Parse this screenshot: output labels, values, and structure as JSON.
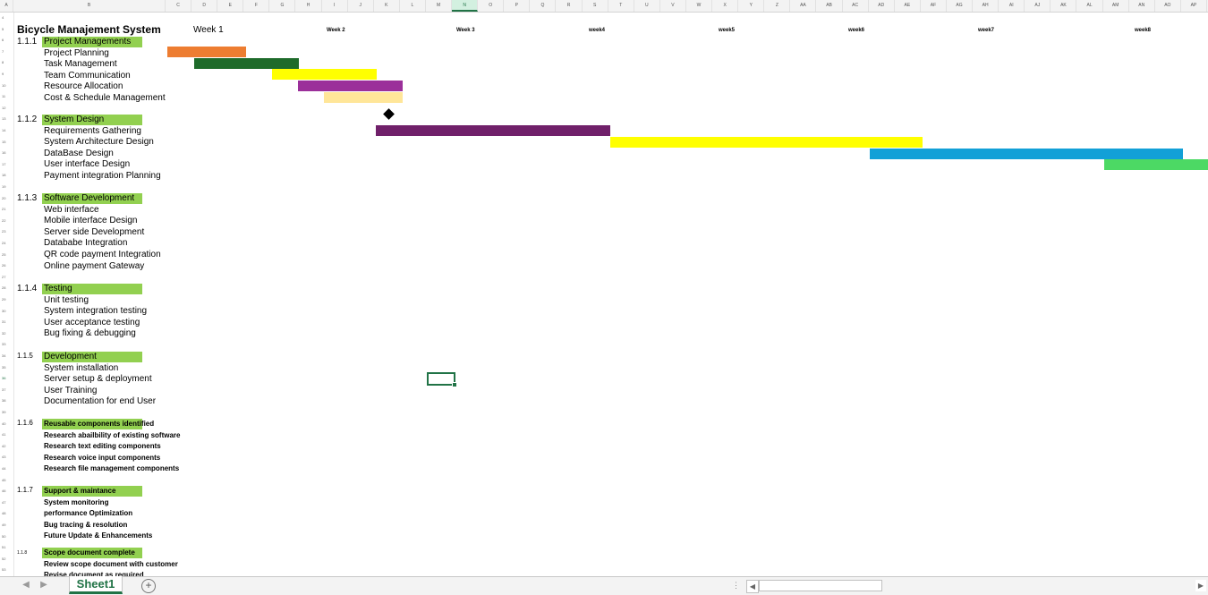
{
  "sheet": {
    "title": "Bicycle Manajement System",
    "week_labels": [
      "Week 1",
      "Week 2",
      "Week 3",
      "week4",
      "week5",
      "week6",
      "week7",
      "week8"
    ],
    "columns": [
      "A",
      "B",
      "C",
      "D",
      "E",
      "F",
      "G",
      "H",
      "I",
      "J",
      "K",
      "L",
      "M",
      "N",
      "O",
      "P",
      "Q",
      "R",
      "S",
      "T",
      "U",
      "V",
      "W",
      "X",
      "Y",
      "Z",
      "AA",
      "AB",
      "AC",
      "AD",
      "AE",
      "AF",
      "AG",
      "AH",
      "AI",
      "AJ",
      "AK",
      "AL",
      "AM",
      "AN",
      "AO",
      "AP",
      "AQ"
    ],
    "selected_column": "N",
    "row_numbers": [
      "4",
      "5",
      "6",
      "7",
      "8",
      "9",
      "10",
      "11",
      "12",
      "13",
      "14",
      "15",
      "16",
      "17",
      "18",
      "19",
      "20",
      "21",
      "22",
      "23",
      "24",
      "25",
      "26",
      "27",
      "28",
      "29",
      "30",
      "31",
      "32",
      "33",
      "34",
      "35",
      "36",
      "37",
      "38",
      "39",
      "40",
      "41",
      "42",
      "43",
      "44",
      "45",
      "46",
      "47",
      "48",
      "49",
      "50",
      "51",
      "52",
      "53",
      "54",
      "55"
    ],
    "selected_row": "36",
    "sections": [
      {
        "code": "1.1.1",
        "name": "Project Managements",
        "tasks": [
          "Project Planning",
          "Task Management",
          "Team Communication",
          "Resource Allocation",
          "Cost & Schedule Management"
        ]
      },
      {
        "code": "1.1.2",
        "name": "System Design",
        "tasks": [
          "Requirements Gathering",
          "System Architecture  Design",
          "DataBase Design",
          "User interface Design",
          "Payment integration Planning"
        ]
      },
      {
        "code": "1.1.3",
        "name": "Software Development",
        "tasks": [
          "Web interface",
          "Mobile interface Design",
          "Server side Development",
          "Datababe Integration",
          "QR code payment Integration",
          "Online payment Gateway"
        ]
      },
      {
        "code": "1.1.4",
        "name": "Testing",
        "tasks": [
          "Unit  testing",
          "System integration testing",
          "User  acceptance  testing",
          "Bug fixing &  debugging"
        ]
      },
      {
        "code": "1.1.5",
        "name": "Development",
        "tasks": [
          "System installation",
          "Server setup  & deployment",
          "User Training",
          "Documentation for end User"
        ]
      },
      {
        "code": "1.1.6",
        "name": "Reusable components identified",
        "tasks": [
          "Research abailbility of existing software",
          "Research text editing components",
          "Research voice input components",
          "Research file management components"
        ]
      },
      {
        "code": "1.1.7",
        "name": "Support & maintance",
        "tasks": [
          "System monitoring",
          "performance Optimization",
          "Bug tracing & resolution",
          "Future Update & Enhancements"
        ]
      },
      {
        "code": "1.1.8",
        "name": "Scope document complete",
        "tasks": [
          "Review scope document with customer",
          "Revise document as required"
        ]
      }
    ],
    "gantt_bars": [
      {
        "task": "Project Planning",
        "color": "#ed7d31"
      },
      {
        "task": "Task Management",
        "color": "#1e6b2a"
      },
      {
        "task": "Team Communication",
        "color": "#ffff00"
      },
      {
        "task": "Resource Allocation",
        "color": "#9b2f9a"
      },
      {
        "task": "Cost & Schedule Management",
        "color": "#ffe699"
      },
      {
        "task": "Requirements Gathering",
        "color": "#70206a"
      },
      {
        "task": "System Architecture  Design",
        "color": "#ffff00"
      },
      {
        "task": "DataBase Design",
        "color": "#12a0d7"
      },
      {
        "task": "User interface Design",
        "color": "#4cd964"
      }
    ],
    "milestone_color": "#000000"
  },
  "footer": {
    "sheet_tab": "Sheet1",
    "add_sheet": "+",
    "nav_prev": "◀",
    "nav_next": "▶",
    "scroll_left": "◀",
    "scroll_right": "▶",
    "split_dots": "⋮"
  }
}
